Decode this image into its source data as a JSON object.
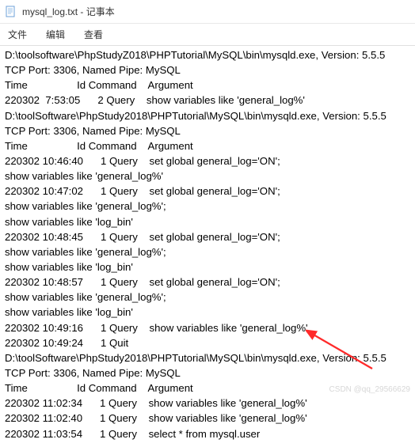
{
  "titlebar": {
    "label": "mysql_log.txt - 记事本"
  },
  "menubar": {
    "file": "文件",
    "edit": "编辑",
    "view": "查看"
  },
  "lines": [
    "D:\\toolsoftware\\PhpStudyZ018\\PHPTutorial\\MySQL\\bin\\mysqld.exe, Version: 5.5.5",
    "TCP Port: 3306, Named Pipe: MySQL",
    "Time                 Id Command    Argument",
    "220302  7:53:05      2 Query    show variables like 'general_log%'",
    "D:\\toolSoftware\\PhpStudy2018\\PHPTutorial\\MySQL\\bin\\mysqld.exe, Version: 5.5.5",
    "TCP Port: 3306, Named Pipe: MySQL",
    "Time                 Id Command    Argument",
    "220302 10:46:40      1 Query    set global general_log='ON';",
    "show variables like 'general_log%'",
    "220302 10:47:02      1 Query    set global general_log='ON';",
    "show variables like 'general_log%';",
    "show variables like 'log_bin'",
    "220302 10:48:45      1 Query    set global general_log='ON';",
    "show variables like 'general_log%';",
    "show variables like 'log_bin'",
    "220302 10:48:57      1 Query    set global general_log='ON';",
    "show variables like 'general_log%';",
    "show variables like 'log_bin'",
    "220302 10:49:16      1 Query    show variables like 'general_log%'",
    "220302 10:49:24      1 Quit",
    "D:\\toolSoftware\\PhpStudy2018\\PHPTutorial\\MySQL\\bin\\mysqld.exe, Version: 5.5.5",
    "TCP Port: 3306, Named Pipe: MySQL",
    "Time                 Id Command    Argument",
    "220302 11:02:34      1 Query    show variables like 'general_log%'",
    "220302 11:02:40      1 Query    show variables like 'general_log%'",
    "220302 11:03:54      1 Query    select * from mysql.user"
  ],
  "watermark": "CSDN @qq_29566629"
}
